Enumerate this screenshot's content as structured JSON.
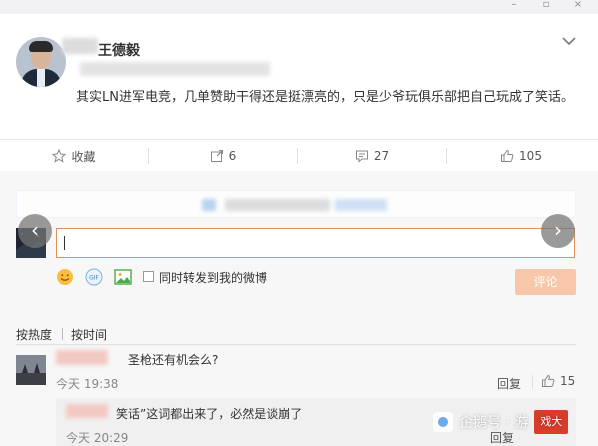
{
  "window": {
    "minimize": "–",
    "maximize": "▫",
    "close": "×"
  },
  "post": {
    "author_name": "王德毅",
    "text": "其实LN进军电竞，几单赞助干得还是挺漂亮的，只是少爷玩俱乐部把自己玩成了笑话。"
  },
  "actions": {
    "favorite": "收藏",
    "repost_count": "6",
    "comment_count": "27",
    "like_count": "105"
  },
  "composer": {
    "forward_label": "同时转发到我的微博",
    "submit_label": "评论",
    "gif_label": "GIF"
  },
  "sort": {
    "hot": "按热度",
    "time": "按时间"
  },
  "comments": [
    {
      "text": "圣枪还有机会么?",
      "time": "今天 19:38",
      "reply": "回复",
      "likes": "15"
    },
    {
      "text": "笑话”这词都出来了，必然是谈崩了",
      "time": "今天 20:29",
      "reply": "回复"
    }
  ],
  "watermark": {
    "text": "企鹅号 · 游",
    "box": "戏大"
  },
  "colors": {
    "accent": "#ff8140",
    "input_border": "#e0905e",
    "submit_disabled": "#f8c7a9"
  }
}
